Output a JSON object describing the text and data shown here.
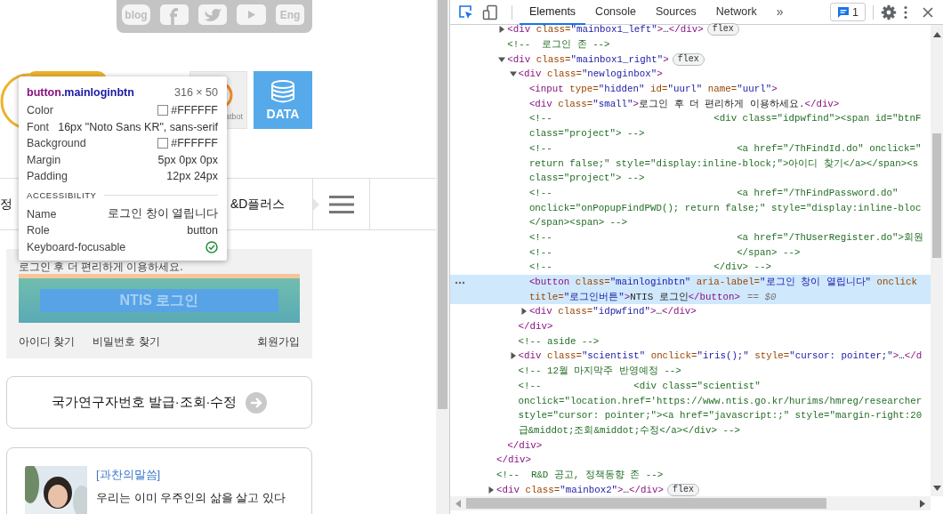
{
  "page": {
    "social": [
      {
        "kind": "blog",
        "label": "blog"
      },
      {
        "kind": "facebook"
      },
      {
        "kind": "twitter"
      },
      {
        "kind": "youtube"
      },
      {
        "kind": "text",
        "label": "Eng"
      }
    ],
    "chatbot": {
      "label": "atbot"
    },
    "data_tile": {
      "label": "DATA"
    },
    "nav": [
      {
        "label": "정"
      },
      {
        "label": "&D플러스"
      }
    ],
    "login": {
      "notice": "로그인 후 더 편리하게 이용하세요.",
      "button": "NTIS 로그인",
      "links": [
        "아이디 찾기",
        "비밀번호 찾기",
        "회원가입"
      ]
    },
    "researcher_card": {
      "label": "국가연구자번호 발급·조회·수정"
    },
    "column_card": {
      "tag": "[과찬의말씀]",
      "title": "우리는 이미 우주인의 삶을 살고 있다"
    },
    "tooltip": {
      "tag": "button",
      "class": ".mainloginbtn",
      "size": "316 × 50",
      "rows": [
        {
          "kind": "color",
          "label": "Color",
          "value": "#FFFFFF"
        },
        {
          "kind": "text",
          "label": "Font",
          "value": "16px \"Noto Sans KR\", sans-serif"
        },
        {
          "kind": "color",
          "label": "Background",
          "value": "#FFFFFF"
        },
        {
          "kind": "text",
          "label": "Margin",
          "value": "5px 0px 0px"
        },
        {
          "kind": "text",
          "label": "Padding",
          "value": "12px 24px"
        }
      ],
      "section": "ACCESSIBILITY",
      "a11y": [
        {
          "kind": "text",
          "label": "Name",
          "value": "로그인 창이 열립니다"
        },
        {
          "kind": "text",
          "label": "Role",
          "value": "button"
        },
        {
          "kind": "check",
          "label": "Keyboard-focusable",
          "checked": true
        }
      ]
    }
  },
  "devtools": {
    "tabs": [
      {
        "label": "Elements",
        "selected": true
      },
      {
        "label": "Console",
        "selected": false
      },
      {
        "label": "Sources",
        "selected": false
      },
      {
        "label": "Network",
        "selected": false
      }
    ],
    "more_tabs": "»",
    "issues": "1",
    "tree": [
      {
        "children": [
          {
            "lines": [
              {
                "kind": "markup",
                "text": "<div class=\"mainbox1_left\">…</div>"
              }
            ],
            "expanded": false,
            "badge": "flex",
            "selected": false
          },
          {
            "lines": [
              {
                "kind": "comment",
                "text": "<!--  로그인 존 -->"
              }
            ],
            "selected": false
          },
          {
            "lines": [
              {
                "kind": "markup",
                "text": "<div class=\"mainbox1_right\">"
              }
            ],
            "expanded": true,
            "badge": "flex",
            "selected": false,
            "children": [
              {
                "lines": [
                  {
                    "kind": "markup",
                    "text": "<div class=\"newloginbox\">"
                  }
                ],
                "expanded": true,
                "selected": false,
                "children": [
                  {
                    "lines": [
                      {
                        "kind": "markup",
                        "text": "<input type=\"hidden\" id=\"uurl\" name=\"uurl\">"
                      }
                    ],
                    "selected": false
                  },
                  {
                    "lines": [
                      {
                        "kind": "markup",
                        "text": "<div class=\"small\">로그인 후 더 편리하게 이용하세요.</div>"
                      }
                    ],
                    "selected": false
                  },
                  {
                    "lines": [
                      {
                        "kind": "comment",
                        "text": "<!--                            <div class=\"idpwfind\"><span id=\"btnF"
                      },
                      {
                        "kind": "comment",
                        "text": "class=\"project\"> -->"
                      }
                    ],
                    "selected": false
                  },
                  {
                    "lines": [
                      {
                        "kind": "comment",
                        "text": "<!--                                <a href=\"/ThFindId.do\" onclick=\""
                      },
                      {
                        "kind": "comment",
                        "text": "return false;\" style=\"display:inline-block;\">아이디 찾기</a></span><s"
                      },
                      {
                        "kind": "comment",
                        "text": "class=\"project\"> -->"
                      }
                    ],
                    "selected": false
                  },
                  {
                    "lines": [
                      {
                        "kind": "comment",
                        "text": "<!--                                <a href=\"/ThFindPassword.do\""
                      },
                      {
                        "kind": "comment",
                        "text": "onclick=\"onPopupFindPWD(); return false;\" style=\"display:inline-bloc"
                      },
                      {
                        "kind": "comment",
                        "text": "</span><span> -->"
                      }
                    ],
                    "selected": false
                  },
                  {
                    "lines": [
                      {
                        "kind": "comment",
                        "text": "<!--                                <a href=\"/ThUserRegister.do\">회원"
                      }
                    ],
                    "selected": false
                  },
                  {
                    "lines": [
                      {
                        "kind": "comment",
                        "text": "<!--                                </span> -->"
                      }
                    ],
                    "selected": false
                  },
                  {
                    "lines": [
                      {
                        "kind": "comment",
                        "text": "<!--                            </div> -->"
                      }
                    ],
                    "selected": false
                  },
                  {
                    "lines": [
                      {
                        "kind": "markup",
                        "text": "<button class=\"mainloginbtn\" aria-label=\"로그인 창이 열립니다\" onclick"
                      },
                      {
                        "kind": "attrs",
                        "text": "title=\"로그인버튼\">NTIS 로그인</button>"
                      }
                    ],
                    "selected": true,
                    "ref": "== $0"
                  },
                  {
                    "lines": [
                      {
                        "kind": "markup",
                        "text": "<div class=\"idpwfind\">…</div>"
                      }
                    ],
                    "expanded": false,
                    "selected": false
                  }
                ],
                "close": "</div>"
              },
              {
                "lines": [
                  {
                    "kind": "comment",
                    "text": "<!-- aside -->"
                  }
                ],
                "selected": false
              },
              {
                "lines": [
                  {
                    "kind": "markup",
                    "text": "<div class=\"scientist\" onclick=\"iris();\" style=\"cursor: pointer;\">…</d"
                  }
                ],
                "expanded": false,
                "selected": false
              },
              {
                "lines": [
                  {
                    "kind": "comment",
                    "text": "<!-- 12월 마지막주 반영예정 -->"
                  }
                ],
                "selected": false
              },
              {
                "lines": [
                  {
                    "kind": "comment",
                    "text": "<!--                <div class=\"scientist\""
                  },
                  {
                    "kind": "comment",
                    "text": "onclick=\"location.href='https://www.ntis.go.kr/hurims/hmreg/researcher"
                  },
                  {
                    "kind": "comment",
                    "text": "style=\"cursor: pointer;\"><a href=\"javascript:;\" style=\"margin-right:20"
                  },
                  {
                    "kind": "comment",
                    "text": "급&middot;조회&middot;수정</a></div> -->"
                  }
                ],
                "selected": false
              }
            ],
            "close": "</div>"
          }
        ],
        "close": "</div>"
      },
      {
        "lines": [
          {
            "kind": "comment",
            "text": "<!--  R&D 공고, 정책동향 존 -->"
          }
        ],
        "selected": false
      },
      {
        "lines": [
          {
            "kind": "markup",
            "text": "<div class=\"mainbox2\">…</div>"
          }
        ],
        "expanded": false,
        "badge": "flex",
        "selected": false
      }
    ]
  }
}
